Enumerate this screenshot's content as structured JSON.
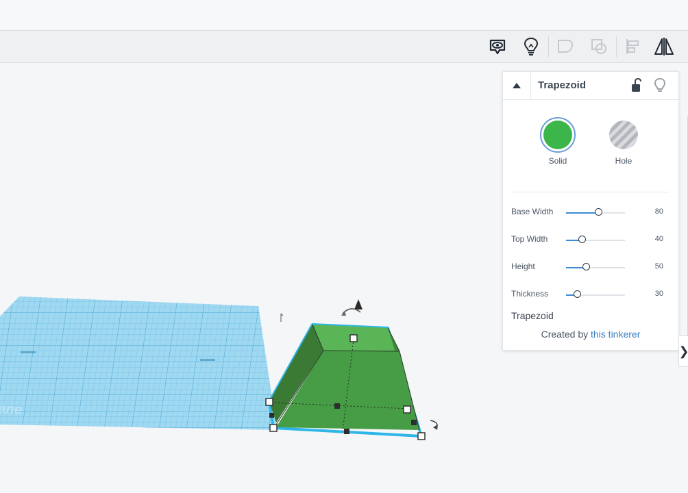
{
  "toolbar": {
    "buttons": [
      {
        "name": "notes-tool",
        "icon": "speech-eye-icon"
      },
      {
        "name": "hints",
        "icon": "lightbulb-icon"
      },
      {
        "name": "group",
        "icon": "group-icon"
      },
      {
        "name": "ungroup",
        "icon": "ungroup-icon"
      },
      {
        "name": "align",
        "icon": "align-icon"
      },
      {
        "name": "mirror",
        "icon": "mirror-icon"
      }
    ]
  },
  "inspector": {
    "title": "Trapezoid",
    "types": {
      "solid": {
        "label": "Solid",
        "color": "#3cb54a"
      },
      "hole": {
        "label": "Hole"
      }
    },
    "params": [
      {
        "label": "Base Width",
        "value": "80",
        "fraction": 0.55
      },
      {
        "label": "Top Width",
        "value": "40",
        "fraction": 0.27
      },
      {
        "label": "Height",
        "value": "50",
        "fraction": 0.34
      },
      {
        "label": "Thickness",
        "value": "30",
        "fraction": 0.19
      }
    ],
    "shape_name": "Trapezoid",
    "credit_prefix": "Created by",
    "credit_link": "this tinkerer"
  },
  "workplane": {
    "label": "Workplane"
  },
  "colors": {
    "accent": "#3e8ad6",
    "shape": "#479c46",
    "workplane": "#8fd1ee"
  }
}
